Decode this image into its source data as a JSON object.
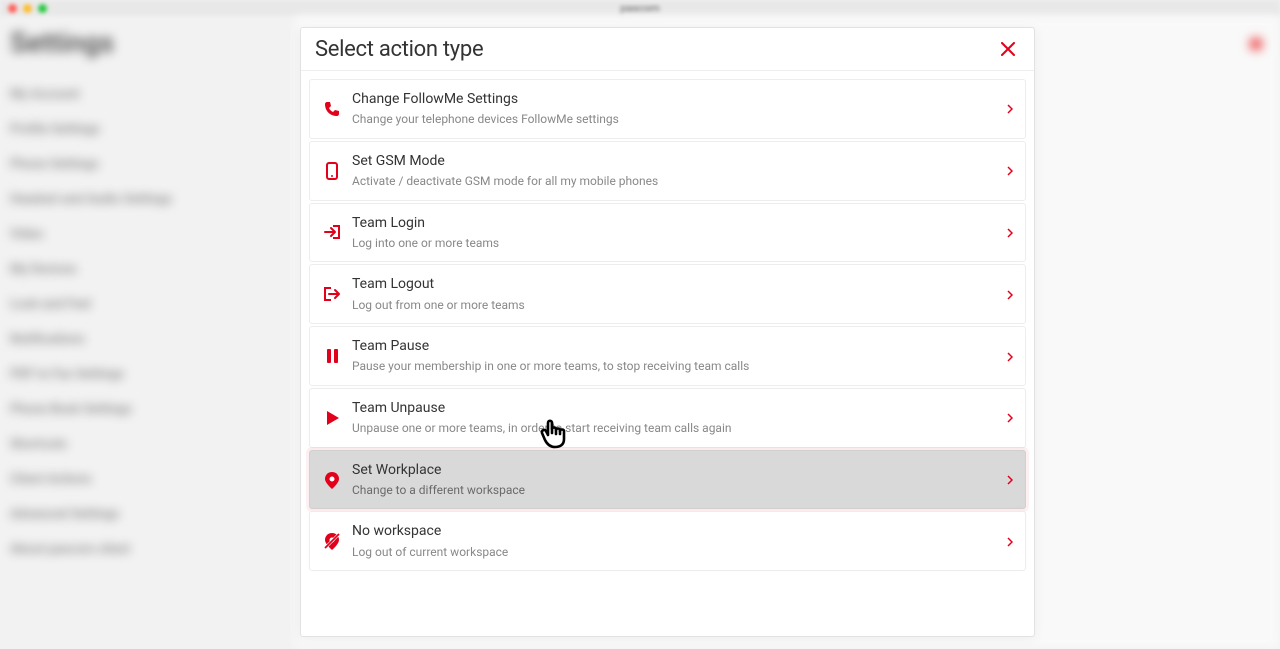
{
  "window": {
    "app_label": "pascom"
  },
  "background": {
    "sidebar_title": "Settings",
    "sidebar_items": [
      "My Account",
      "Profile Settings",
      "Phone Settings",
      "Headset and Audio Settings",
      "Video",
      "My Devices",
      "Look and Feel",
      "Notifications",
      "PDF to Fax Settings",
      "Phone Book Settings",
      "Shortcuts",
      "Client Actions",
      "Advanced Settings",
      "About pascom client"
    ]
  },
  "modal": {
    "title": "Select action type",
    "close_label": "Close",
    "actions": [
      {
        "icon": "phone-icon",
        "title": "Change FollowMe Settings",
        "desc": "Change your telephone devices FollowMe settings",
        "highlight": false
      },
      {
        "icon": "mobile-icon",
        "title": "Set GSM Mode",
        "desc": "Activate / deactivate GSM mode for all my mobile phones",
        "highlight": false
      },
      {
        "icon": "login-icon",
        "title": "Team Login",
        "desc": "Log into one or more teams",
        "highlight": false
      },
      {
        "icon": "logout-icon",
        "title": "Team Logout",
        "desc": "Log out from one or more teams",
        "highlight": false
      },
      {
        "icon": "pause-icon",
        "title": "Team Pause",
        "desc": "Pause your membership in one or more teams, to stop receiving team calls",
        "highlight": false
      },
      {
        "icon": "play-icon",
        "title": "Team Unpause",
        "desc": "Unpause one or more teams, in order to start receiving team calls again",
        "highlight": false
      },
      {
        "icon": "pin-icon",
        "title": "Set Workplace",
        "desc": "Change to a different workspace",
        "highlight": true
      },
      {
        "icon": "pin-off-icon",
        "title": "No workspace",
        "desc": "Log out of current workspace",
        "highlight": false
      }
    ]
  },
  "colors": {
    "accent": "#e2001a"
  }
}
